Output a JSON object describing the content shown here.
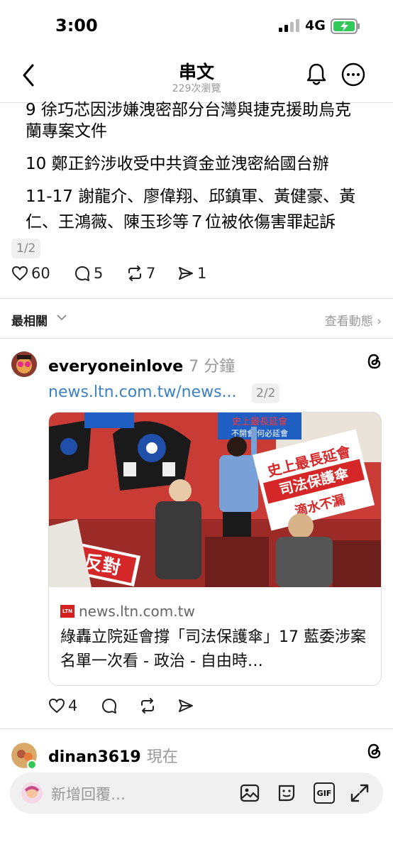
{
  "status": {
    "time": "3:00",
    "network": "4G"
  },
  "nav": {
    "title": "串文",
    "views": "229次瀏覽"
  },
  "thread": {
    "lines": [
      "9 徐巧芯因涉嫌洩密部分台灣與捷克援助烏克",
      "蘭專案文件",
      "10 鄭正鈐涉收受中共資金並洩密給國台辦",
      "11-17 謝龍介、廖偉翔、邱鎮軍、黃健豪、黃",
      "仁、王鴻薇、陳玉珍等７位被依傷害罪起訴"
    ],
    "page": "1/2",
    "likes": "60",
    "comments": "5",
    "reposts": "7",
    "shares": "1"
  },
  "sort": {
    "label": "最相關",
    "activity": "查看動態"
  },
  "reply1": {
    "username": "everyoneinlove",
    "time": "7 分鐘",
    "link": "news.ltn.com.tw/news...",
    "page": "2/2",
    "card_domain": "news.ltn.com.tw",
    "card_logo": "LTN",
    "card_title": "綠轟立院延會撐「司法保護傘」17 藍委涉案名單一次看 - 政治 - 自由時…",
    "likes": "4",
    "image_signs": {
      "sign1": "史上最長延會",
      "sign2": "司法保護傘",
      "sign3": "滴水不漏",
      "sign4": "反對",
      "sign5": "不開會 何必延會"
    }
  },
  "reply2": {
    "username": "dinan3619",
    "time": "現在"
  },
  "reply_bar": {
    "placeholder": "新增回覆…",
    "gif": "GIF"
  },
  "colors": {
    "link": "#3b82c4",
    "battery": "#34c759",
    "sign_red": "#d62728"
  }
}
